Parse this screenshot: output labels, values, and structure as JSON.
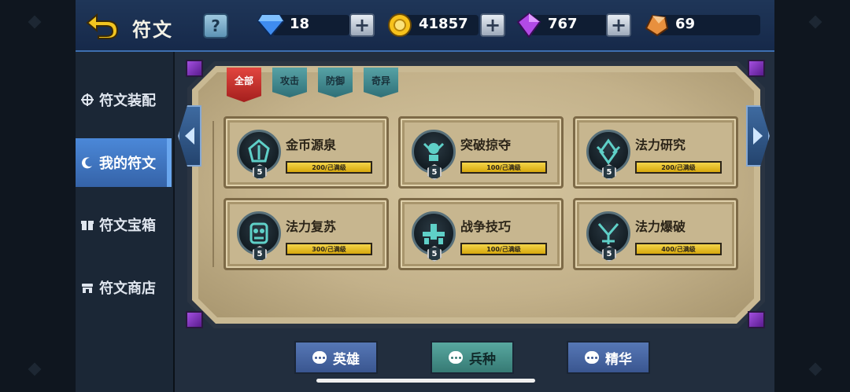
{
  "header": {
    "title": "符文",
    "help_label": "?",
    "resources": [
      {
        "name": "diamond",
        "icon": "diamond-icon",
        "value": "18"
      },
      {
        "name": "gold",
        "icon": "gold-coin-icon",
        "value": "41857"
      },
      {
        "name": "crystal",
        "icon": "purple-crystal-icon",
        "value": "767"
      },
      {
        "name": "ore",
        "icon": "ore-icon",
        "value": "69"
      }
    ],
    "plus_label": "+"
  },
  "sidebar": {
    "items": [
      {
        "label": "符文装配",
        "icon": "target-icon",
        "active": false
      },
      {
        "label": "我的符文",
        "icon": "crescent-icon",
        "active": true
      },
      {
        "label": "符文宝箱",
        "icon": "gift-box-icon",
        "active": false
      },
      {
        "label": "符文商店",
        "icon": "shop-icon",
        "active": false
      }
    ]
  },
  "tabs": [
    {
      "label": "全部",
      "active": true
    },
    {
      "label": "攻击",
      "active": false
    },
    {
      "label": "防御",
      "active": false
    },
    {
      "label": "奇异",
      "active": false
    }
  ],
  "runes": [
    {
      "name": "金币源泉",
      "level": "5",
      "progress_text": "200/己满级",
      "progress": 1.0
    },
    {
      "name": "突破掠夺",
      "level": "5",
      "progress_text": "100/己满级",
      "progress": 1.0
    },
    {
      "name": "法力研究",
      "level": "5",
      "progress_text": "200/己满级",
      "progress": 1.0
    },
    {
      "name": "法力复苏",
      "level": "5",
      "progress_text": "300/己满级",
      "progress": 1.0
    },
    {
      "name": "战争技巧",
      "level": "5",
      "progress_text": "100/己满级",
      "progress": 1.0
    },
    {
      "name": "法力爆破",
      "level": "5",
      "progress_text": "400/己满级",
      "progress": 1.0
    }
  ],
  "bottom_buttons": [
    {
      "label": "英雄",
      "style": "blue"
    },
    {
      "label": "兵种",
      "style": "teal"
    },
    {
      "label": "精华",
      "style": "blue"
    }
  ],
  "colors": {
    "header_bg": "#1f3658",
    "nav_active": "#4b88d8",
    "tab_active": "#e2463f",
    "tab_idle": "#57a2a5",
    "progress_fill": "#f4d54a",
    "parchment": "#c9b993"
  }
}
